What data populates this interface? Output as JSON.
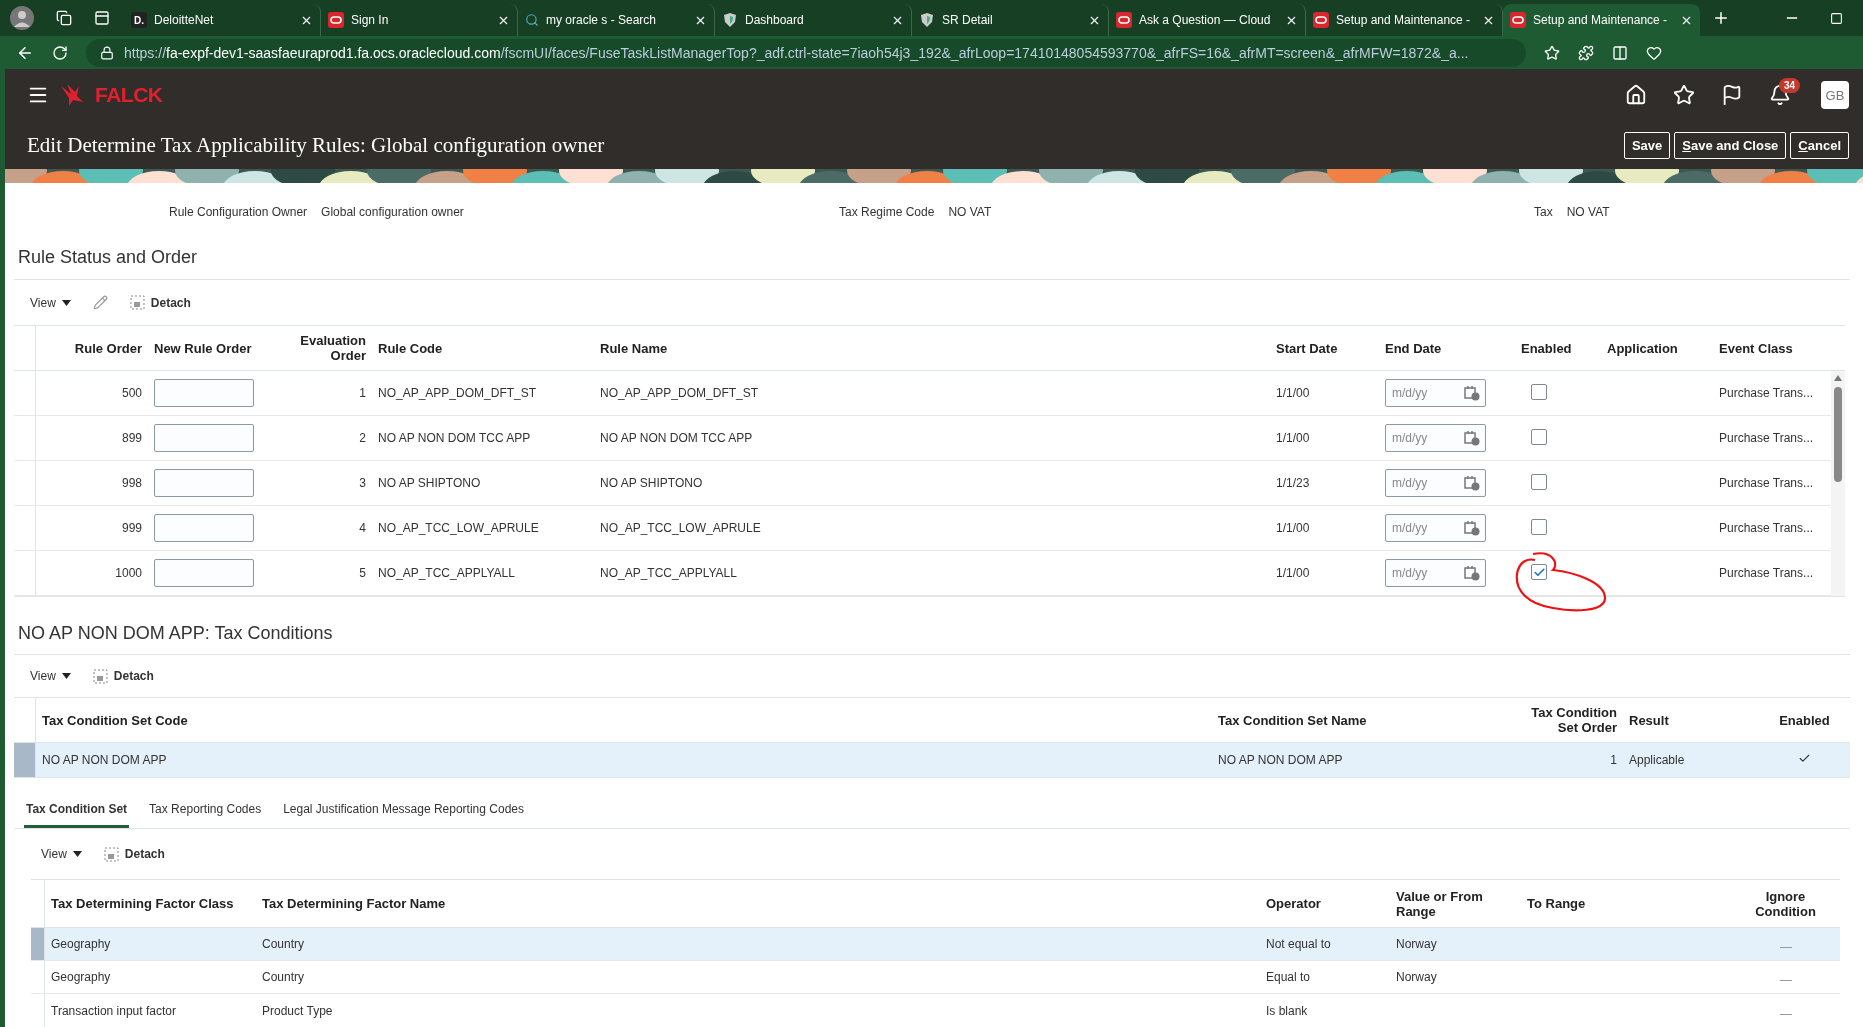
{
  "browser": {
    "tabs": [
      {
        "title": "DeloitteNet",
        "kind": "letter",
        "favicon_text": "D.",
        "selected": false
      },
      {
        "title": "Sign In",
        "kind": "oracle",
        "selected": false
      },
      {
        "title": "my oracle s - Search",
        "kind": "search",
        "selected": false
      },
      {
        "title": "Dashboard",
        "kind": "shield",
        "selected": false
      },
      {
        "title": "SR Detail",
        "kind": "shield",
        "selected": false
      },
      {
        "title": "Ask a Question — Cloud",
        "kind": "oracle",
        "selected": false
      },
      {
        "title": "Setup and Maintenance -",
        "kind": "oracle",
        "selected": false
      },
      {
        "title": "Setup and Maintenance -",
        "kind": "oracle",
        "selected": true
      }
    ],
    "url_scheme": "https://",
    "url_host": "fa-expf-dev1-saasfaeuraprod1.fa.ocs.oraclecloud.com",
    "url_path": "/fscmUI/faces/FuseTaskListManagerTop?_adf.ctrl-state=7iaoh54j3_192&_afrLoop=17410148054593770&_afrFS=16&_afrMT=screen&_afrMFW=1872&_a..."
  },
  "app": {
    "logo": "FALCK",
    "notifications": "34",
    "avatar": "GB"
  },
  "page": {
    "title": "Edit Determine Tax Applicability Rules: Global configuration owner",
    "buttons": [
      {
        "label": "Save",
        "underline_first": false
      },
      {
        "label": "Save and Close",
        "underline_first": true
      },
      {
        "label": "Cancel",
        "underline_first": true
      }
    ]
  },
  "info": [
    {
      "label": "Rule Configuration Owner",
      "value": "Global configuration owner"
    },
    {
      "label": "Tax Regime Code",
      "value": "NO VAT"
    },
    {
      "label": "Tax",
      "value": "NO VAT"
    }
  ],
  "rules": {
    "title": "Rule Status and Order",
    "toolbar": {
      "view": "View",
      "detach": "Detach"
    },
    "columns": [
      "Rule Order",
      "New Rule Order",
      "Evaluation Order",
      "Rule Code",
      "Rule Name",
      "Start Date",
      "End Date",
      "Enabled",
      "Application",
      "Event Class"
    ],
    "rows": [
      {
        "rule_order": "500",
        "evaluation_order": "1",
        "rule_code": "NO_AP_APP_DOM_DFT_ST",
        "rule_name": "NO_AP_APP_DOM_DFT_ST",
        "start_date": "1/1/00",
        "end_date_placeholder": "m/d/yy",
        "enabled": false,
        "circled": false,
        "event_class": "Purchase Trans..."
      },
      {
        "rule_order": "899",
        "evaluation_order": "2",
        "rule_code": "NO AP NON DOM TCC APP",
        "rule_name": "NO AP NON DOM TCC APP",
        "start_date": "1/1/00",
        "end_date_placeholder": "m/d/yy",
        "enabled": false,
        "circled": false,
        "event_class": "Purchase Trans..."
      },
      {
        "rule_order": "998",
        "evaluation_order": "3",
        "rule_code": "NO AP SHIPTONO",
        "rule_name": "NO AP SHIPTONO",
        "start_date": "1/1/23",
        "end_date_placeholder": "m/d/yy",
        "enabled": false,
        "circled": false,
        "event_class": "Purchase Trans..."
      },
      {
        "rule_order": "999",
        "evaluation_order": "4",
        "rule_code": "NO_AP_TCC_LOW_APRULE",
        "rule_name": "NO_AP_TCC_LOW_APRULE",
        "start_date": "1/1/00",
        "end_date_placeholder": "m/d/yy",
        "enabled": false,
        "circled": false,
        "event_class": "Purchase Trans..."
      },
      {
        "rule_order": "1000",
        "evaluation_order": "5",
        "rule_code": "NO_AP_TCC_APPLYALL",
        "rule_name": "NO_AP_TCC_APPLYALL",
        "start_date": "1/1/00",
        "end_date_placeholder": "m/d/yy",
        "enabled": true,
        "circled": true,
        "event_class": "Purchase Trans..."
      }
    ]
  },
  "conditions": {
    "title": "NO AP NON DOM APP: Tax Conditions",
    "toolbar": {
      "view": "View",
      "detach": "Detach"
    },
    "columns": [
      "Tax Condition Set Code",
      "Tax Condition Set Name",
      "Tax Condition Set Order",
      "Result",
      "Enabled"
    ],
    "rows": [
      {
        "code": "NO AP NON DOM APP",
        "name": "NO AP NON DOM APP",
        "order": "1",
        "result": "Applicable",
        "enabled": true,
        "selected": true
      }
    ]
  },
  "subtabs": [
    {
      "label": "Tax Condition Set",
      "selected": true
    },
    {
      "label": "Tax Reporting Codes",
      "selected": false
    },
    {
      "label": "Legal Justification Message Reporting Codes",
      "selected": false
    }
  ],
  "factors": {
    "toolbar": {
      "view": "View",
      "detach": "Detach"
    },
    "columns": [
      "Tax Determining Factor Class",
      "Tax Determining Factor Name",
      "Operator",
      "Value or From Range",
      "To Range",
      "Ignore Condition"
    ],
    "rows": [
      {
        "factor_class": "Geography",
        "factor_name": "Country",
        "operator": "Not equal to",
        "value": "Norway",
        "ignore_condition": false,
        "selected": true
      },
      {
        "factor_class": "Geography",
        "factor_name": "Country",
        "operator": "Equal to",
        "value": "Norway",
        "ignore_condition": false,
        "selected": false
      },
      {
        "factor_class": "Transaction input factor",
        "factor_name": "Product Type",
        "operator": "Is blank",
        "ignore_condition": false,
        "selected": false
      }
    ]
  }
}
